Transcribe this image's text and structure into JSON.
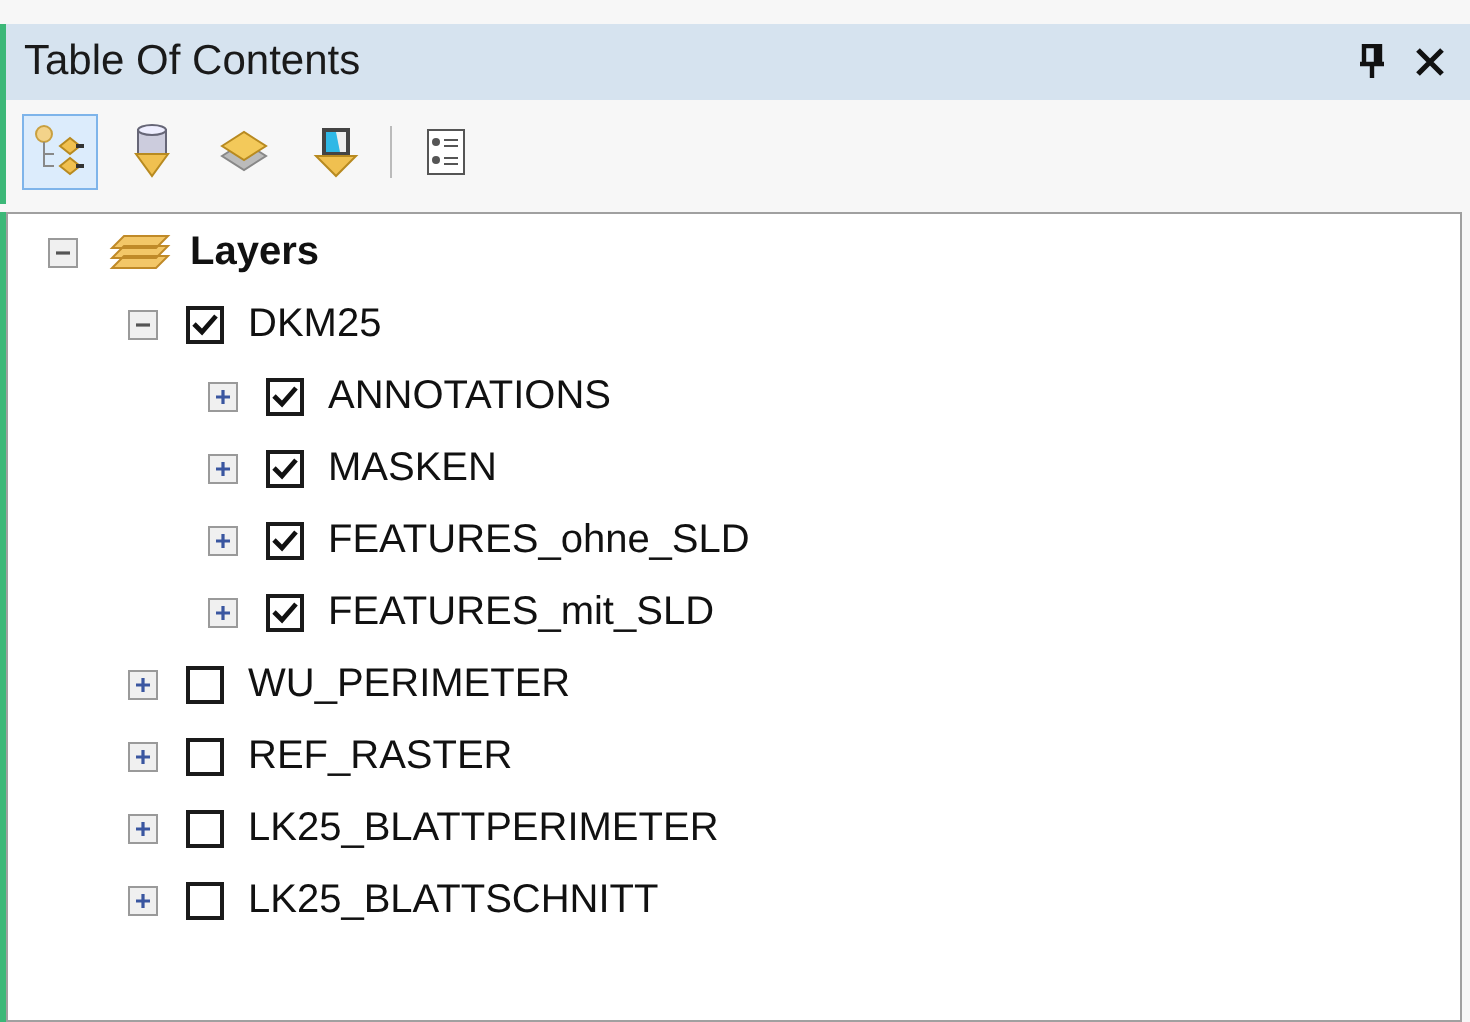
{
  "window": {
    "title": "Table Of Contents"
  },
  "toolbar": [
    {
      "kind": "drawing-order",
      "selected": true
    },
    {
      "kind": "source",
      "selected": false
    },
    {
      "kind": "visibility",
      "selected": false
    },
    {
      "kind": "selection",
      "selected": false
    },
    {
      "kind": "options",
      "selected": false
    }
  ],
  "tree": [
    {
      "label": "Layers",
      "kind": "frame",
      "expanded": true,
      "children": [
        {
          "label": "DKM25",
          "checked": true,
          "expanded": true,
          "children": [
            {
              "label": "ANNOTATIONS",
              "checked": true,
              "expanded": false
            },
            {
              "label": "MASKEN",
              "checked": true,
              "expanded": false
            },
            {
              "label": "FEATURES_ohne_SLD",
              "checked": true,
              "expanded": false
            },
            {
              "label": "FEATURES_mit_SLD",
              "checked": true,
              "expanded": false
            }
          ]
        },
        {
          "label": "WU_PERIMETER",
          "checked": false,
          "expanded": false
        },
        {
          "label": "REF_RASTER",
          "checked": false,
          "expanded": false
        },
        {
          "label": "LK25_BLATTPERIMETER",
          "checked": false,
          "expanded": false
        },
        {
          "label": "LK25_BLATTSCHNITT",
          "checked": false,
          "expanded": false
        }
      ]
    }
  ]
}
